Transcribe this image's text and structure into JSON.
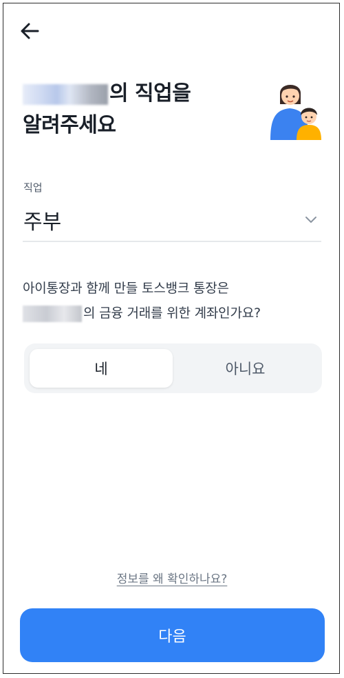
{
  "nav": {
    "back_icon": "arrow-left-icon"
  },
  "header": {
    "title_line1_suffix": "의 직업을",
    "title_line2": "알려주세요",
    "illustration": "parent-and-child-illustration"
  },
  "job": {
    "label": "직업",
    "value": "주부",
    "dropdown_icon": "chevron-down-icon"
  },
  "question": {
    "line1": "아이통장과 함께 만들 토스뱅크 통장은",
    "line2_suffix": "의 금융 거래를 위한 계좌인가요?"
  },
  "answer_toggle": {
    "options": [
      "네",
      "아니요"
    ],
    "selected": "네"
  },
  "info_link": "정보를 왜 확인하나요?",
  "primary_button": "다음",
  "colors": {
    "primary": "#3182f6",
    "toggle_bg": "#f2f4f6",
    "text_strong": "#191f28",
    "text_muted": "#6b7684"
  }
}
